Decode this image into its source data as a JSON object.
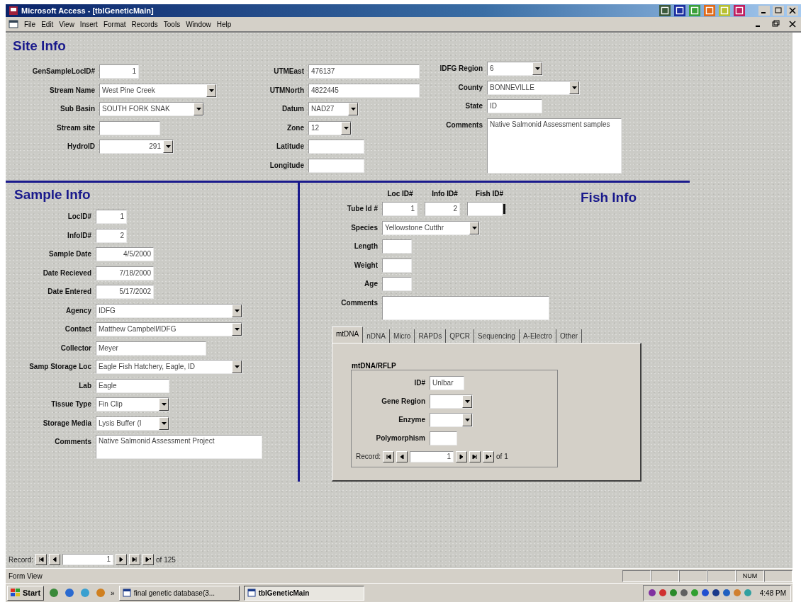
{
  "window": {
    "title": "Microsoft Access - [tblGeneticMain]"
  },
  "menu": [
    "File",
    "Edit",
    "View",
    "Insert",
    "Format",
    "Records",
    "Tools",
    "Window",
    "Help"
  ],
  "site_info": {
    "title": "Site Info",
    "columns": [
      [
        {
          "label": "GenSampleLocID#",
          "value": "1",
          "kind": "number"
        },
        {
          "label": "Stream Name",
          "value": "West Pine Creek",
          "kind": "combo"
        },
        {
          "label": "Sub Basin",
          "value": "SOUTH FORK SNAK",
          "kind": "combo"
        },
        {
          "label": "Stream site",
          "kind": "text"
        },
        {
          "label": "HydroID",
          "value": "291",
          "kind": "number-combo"
        }
      ],
      [
        {
          "label": "UTMEast",
          "value": "476137",
          "kind": "text"
        },
        {
          "label": "UTMNorth",
          "value": "4822445",
          "kind": "text"
        },
        {
          "label": "Datum",
          "value": "NAD27",
          "kind": "combo"
        },
        {
          "label": "Zone",
          "value": "12",
          "kind": "combo"
        },
        {
          "label": "Latitude",
          "kind": "text"
        },
        {
          "label": "Longitude",
          "kind": "text"
        }
      ],
      [
        {
          "label": "IDFG Region",
          "value": "6",
          "kind": "combo"
        },
        {
          "label": "County",
          "value": "BONNEVILLE",
          "kind": "combo"
        },
        {
          "label": "State",
          "value": "ID",
          "kind": "text"
        },
        {
          "label": "Comments",
          "value": "Native Salmonid Assessment samples",
          "kind": "memo"
        }
      ]
    ]
  },
  "sample_info": {
    "title": "Sample Info",
    "fields": [
      {
        "label": "LocID#",
        "value": "1",
        "kind": "number"
      },
      {
        "label": "InfoID#",
        "value": "2",
        "kind": "number"
      },
      {
        "label": "Sample Date",
        "value": "4/5/2000",
        "kind": "number"
      },
      {
        "label": "Date Recieved",
        "value": "7/18/2000",
        "kind": "number"
      },
      {
        "label": "Date Entered",
        "value": "5/17/2002",
        "kind": "number"
      },
      {
        "label": "Agency",
        "value": "IDFG",
        "kind": "combo"
      },
      {
        "label": "Contact",
        "value": "Matthew Campbell/IDFG",
        "kind": "combo"
      },
      {
        "label": "Collector",
        "value": "Meyer",
        "kind": "text"
      },
      {
        "label": "Samp Storage Loc",
        "value": "Eagle Fish Hatchery, Eagle, ID",
        "kind": "combo"
      },
      {
        "label": "Lab",
        "value": "Eagle",
        "kind": "text"
      },
      {
        "label": "Tissue Type",
        "value": "Fin Clip",
        "kind": "combo"
      },
      {
        "label": "Storage Media",
        "value": "Lysis Buffer (I",
        "kind": "combo"
      },
      {
        "label": "Comments",
        "value": "Native Salmonid Assessment Project",
        "kind": "memo"
      }
    ]
  },
  "fish_info": {
    "title": "Fish Info",
    "id_headers": [
      "Loc ID#",
      "Info ID#",
      "Fish ID#"
    ],
    "tube": {
      "label": "Tube Id #",
      "values": [
        "1",
        "2"
      ]
    },
    "fields": [
      {
        "label": "Species",
        "value": "Yellowstone Cutthr",
        "kind": "combo"
      },
      {
        "label": "Length",
        "kind": "text"
      },
      {
        "label": "Weight",
        "kind": "text"
      },
      {
        "label": "Age",
        "kind": "text"
      },
      {
        "label": "Comments",
        "kind": "memo"
      }
    ],
    "tabs": [
      {
        "label": "mtDNA",
        "selected": true
      },
      {
        "label": "nDNA",
        "selected": false
      },
      {
        "label": "Micro",
        "selected": false
      },
      {
        "label": "RAPDs",
        "selected": false
      },
      {
        "label": "QPCR",
        "selected": false
      },
      {
        "label": "Sequencing",
        "selected": false
      },
      {
        "label": "A-Electro",
        "selected": false
      },
      {
        "label": "Other",
        "selected": false
      }
    ],
    "subform": {
      "title": "mtDNA/RFLP",
      "fields": [
        {
          "label": "ID#",
          "value": "Unlbar",
          "kind": "text"
        },
        {
          "label": "Gene Region",
          "kind": "combo"
        },
        {
          "label": "Enzyme",
          "kind": "combo"
        },
        {
          "label": "Polymorphism",
          "kind": "text"
        }
      ],
      "record_nav": {
        "label": "Record:",
        "current": "1",
        "of_text": "of 1"
      }
    }
  },
  "record_nav": {
    "label": "Record:",
    "current": "1",
    "of_text": "of 125"
  },
  "status_bar": {
    "text": "Form View",
    "indicator": "NUM"
  },
  "taskbar": {
    "start": "Start",
    "more": "»",
    "tasks": [
      {
        "label": "final genetic database(3...",
        "selected": false
      },
      {
        "label": "tblGeneticMain",
        "selected": true
      }
    ],
    "clock": "4:48 PM"
  }
}
